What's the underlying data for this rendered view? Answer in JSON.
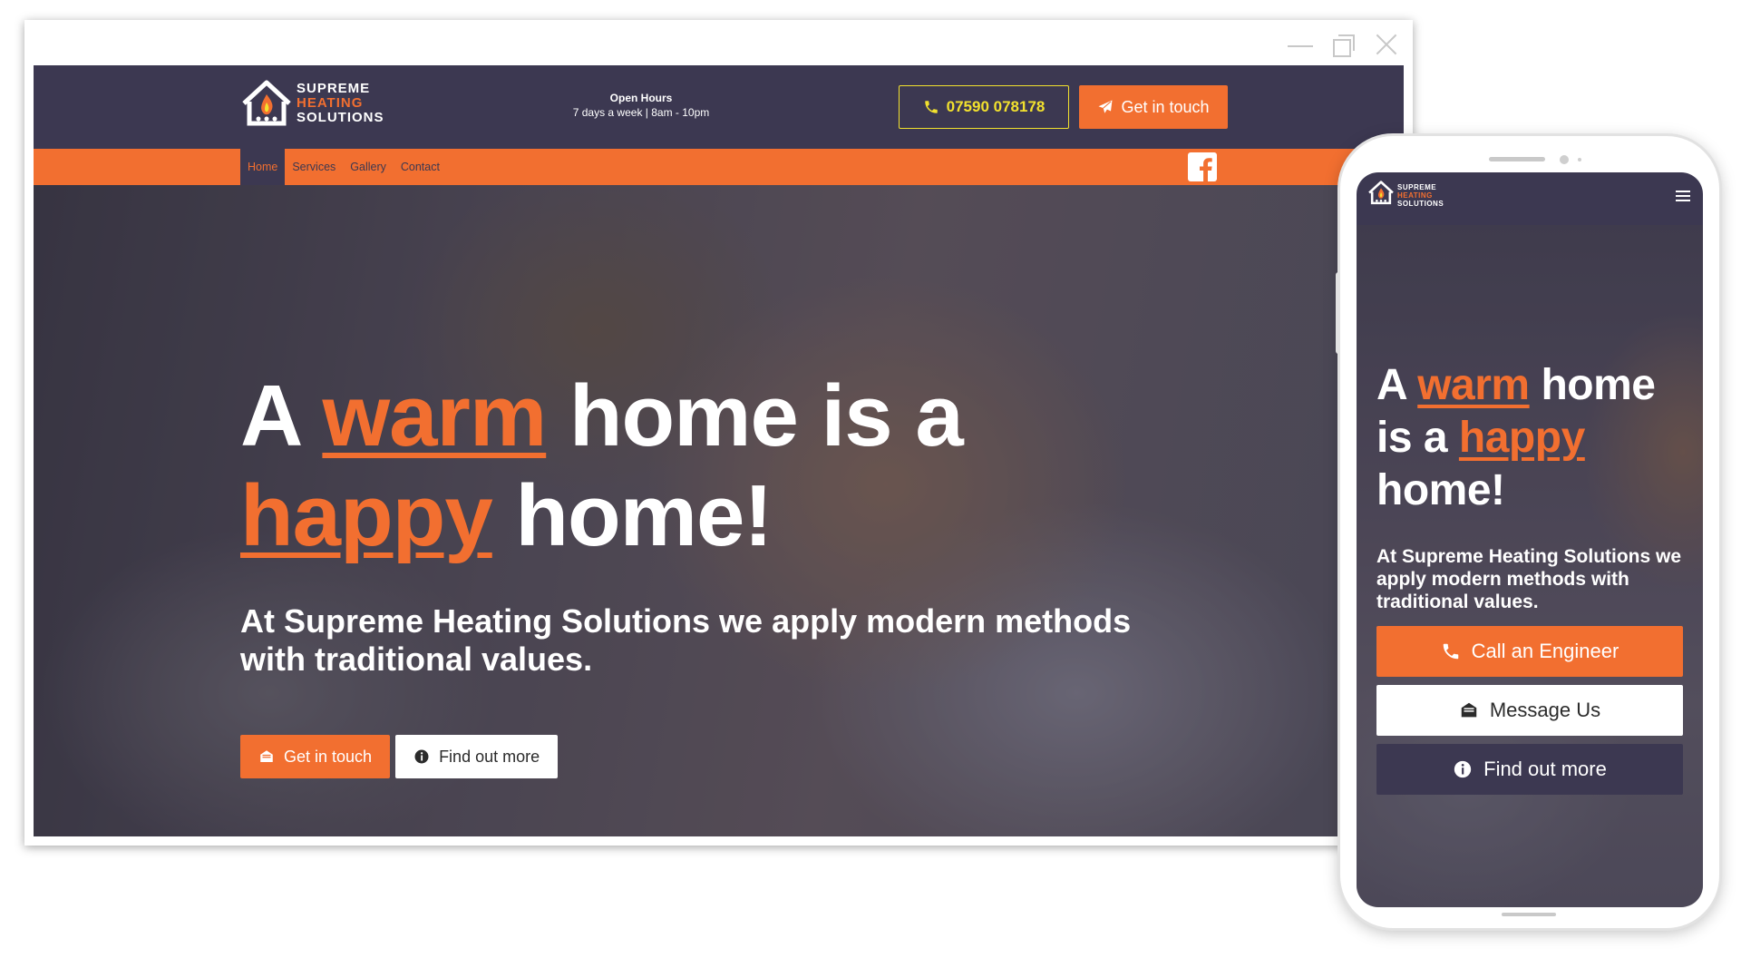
{
  "desktop": {
    "logo": {
      "line1": "SUPREME",
      "line2": "HEATING",
      "line3": "SOLUTIONS"
    },
    "open_hours": {
      "title": "Open Hours",
      "text": "7 days a week | 8am - 10pm"
    },
    "phone_number": "07590 078178",
    "header_cta": "Get in touch",
    "nav": [
      {
        "label": "Home",
        "active": true
      },
      {
        "label": "Services"
      },
      {
        "label": "Gallery"
      },
      {
        "label": "Contact"
      }
    ],
    "hero": {
      "title_part1": "A ",
      "title_accent1": "warm",
      "title_part2": " home is a ",
      "title_accent2": "happy",
      "title_part3": " home!",
      "subtitle": "At Supreme Heating Solutions we apply modern methods with traditional values.",
      "btn_primary": "Get in touch",
      "btn_secondary": "Find out more"
    }
  },
  "mobile": {
    "logo": {
      "line1": "SUPREME",
      "line2": "HEATING",
      "line3": "SOLUTIONS"
    },
    "hero": {
      "title_part1": "A ",
      "title_accent1": "warm",
      "title_part2": " home is a ",
      "title_accent2": "happy",
      "title_part3": " home!",
      "subtitle": "At Supreme Heating Solutions we apply modern methods with traditional values.",
      "btn_call": "Call an Engineer",
      "btn_message": "Message Us",
      "btn_more": "Find out more"
    }
  },
  "colors": {
    "brand_dark": "#3c3851",
    "brand_orange": "#f26f30",
    "phone_yellow": "#f2e12e"
  },
  "icons": [
    "house-flame-logo-icon",
    "phone-icon",
    "paper-plane-icon",
    "facebook-icon",
    "envelope-open-icon",
    "info-circle-icon",
    "hamburger-menu-icon"
  ]
}
